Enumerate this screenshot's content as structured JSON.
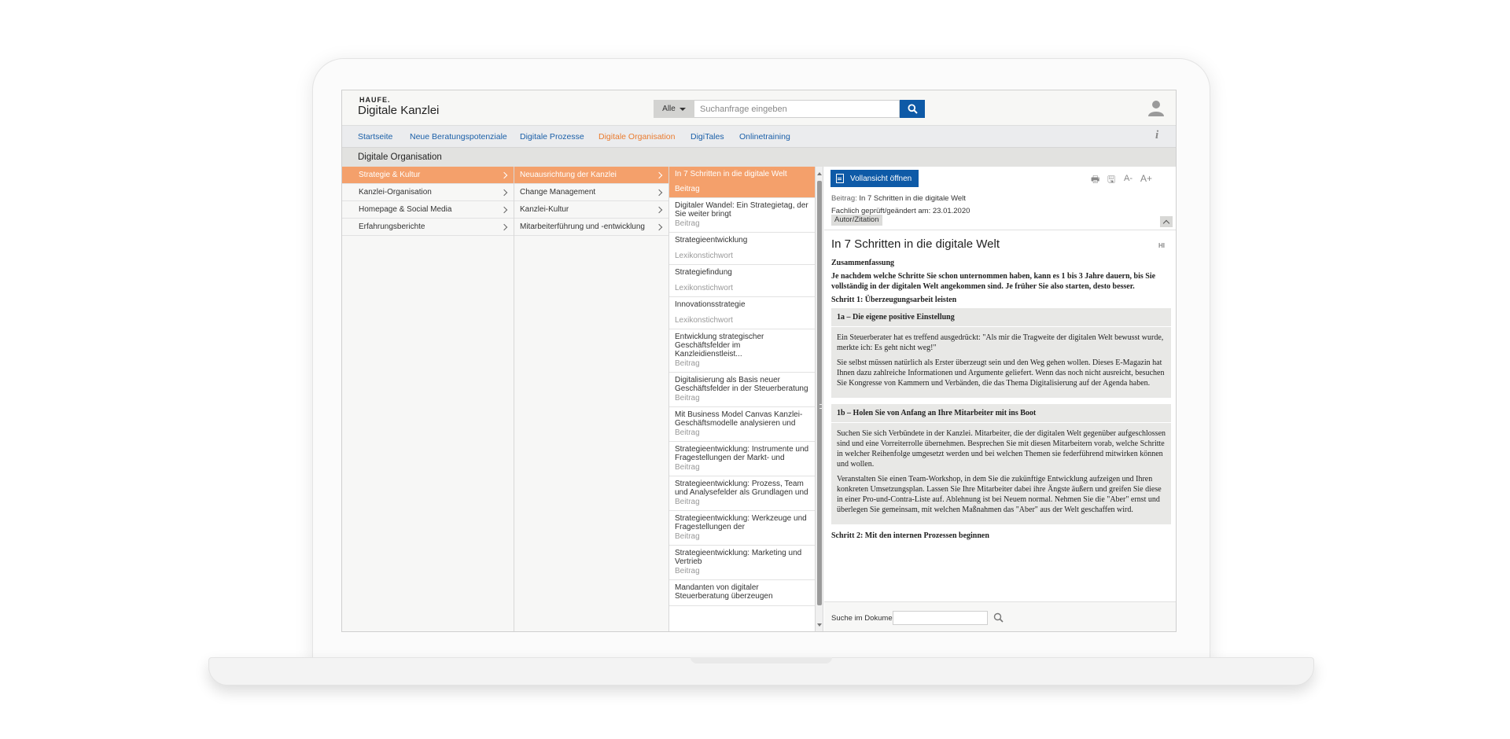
{
  "brand": {
    "small": "HAUFE.",
    "title": "Digitale Kanzlei"
  },
  "search": {
    "scope": "Alle",
    "placeholder": "Suchanfrage eingeben"
  },
  "nav": {
    "items": [
      {
        "label": "Startseite"
      },
      {
        "label": "Neue Beratungspotenziale"
      },
      {
        "label": "Digitale Prozesse"
      },
      {
        "label": "Digitale Organisation"
      },
      {
        "label": "DigiTales"
      },
      {
        "label": "Onlinetraining"
      }
    ],
    "active_index": 3
  },
  "page_title": "Digitale Organisation",
  "categories": [
    {
      "label": "Strategie & Kultur"
    },
    {
      "label": "Kanzlei-Organisation"
    },
    {
      "label": "Homepage & Social Media"
    },
    {
      "label": "Erfahrungsberichte"
    }
  ],
  "subcategories": [
    {
      "label": "Neuausrichtung der Kanzlei"
    },
    {
      "label": "Change Management"
    },
    {
      "label": "Kanzlei-Kultur"
    },
    {
      "label": "Mitarbeiterführung und -entwicklung"
    }
  ],
  "documents": [
    {
      "title": "In 7 Schritten in die digitale Welt",
      "type": "Beitrag"
    },
    {
      "title": "Digitaler Wandel: Ein Strategietag, der Sie weiter bringt",
      "type": "Beitrag"
    },
    {
      "title": "Strategieentwicklung",
      "type": "Lexikonstichwort"
    },
    {
      "title": "Strategiefindung",
      "type": "Lexikonstichwort"
    },
    {
      "title": "Innovationsstrategie",
      "type": "Lexikonstichwort"
    },
    {
      "title": "Entwicklung strategischer Geschäftsfelder im Kanzleidienstleist...",
      "type": "Beitrag"
    },
    {
      "title": "Digitalisierung als Basis neuer Geschäftsfelder in der Steuerberatung",
      "type": "Beitrag"
    },
    {
      "title": "Mit Business Model Canvas Kanzlei-Geschäftsmodelle analysieren und",
      "type": "Beitrag"
    },
    {
      "title": "Strategieentwicklung: Instrumente und Fragestellungen der Markt- und",
      "type": "Beitrag"
    },
    {
      "title": "Strategieentwicklung: Prozess, Team und Analysefelder als Grundlagen und",
      "type": "Beitrag"
    },
    {
      "title": "Strategieentwicklung: Werkzeuge und Fragestellungen der",
      "type": "Beitrag"
    },
    {
      "title": "Strategieentwicklung: Marketing und Vertrieb",
      "type": "Beitrag"
    },
    {
      "title": "Mandanten von digitaler Steuerberatung überzeugen",
      "type": ""
    }
  ],
  "detail": {
    "open_label": "Vollansicht öffnen",
    "tools": {
      "print": "🖶",
      "save": "🖫",
      "smaller": "A-",
      "larger": "A+"
    },
    "article_label": "Beitrag:",
    "article_value": "In 7 Schritten in die digitale Welt",
    "checked_label": "Fachlich geprüft/geändert am:",
    "checked_value": "23.01.2020",
    "cite_label": "Autor/Zitation",
    "title": "In 7 Schritten in die digitale Welt",
    "hl_label": "HI",
    "summary_heading": "Zusammenfassung",
    "summary_text": "Je nachdem welche Schritte Sie schon unternommen haben, kann es 1 bis 3 Jahre dauern, bis Sie vollständig in der digitalen Welt angekommen sind. Je früher Sie also starten, desto besser.",
    "step1_heading": "Schritt 1: Überzeugungsarbeit leisten",
    "box1": {
      "heading": "1a – Die eigene positive Einstellung",
      "p1": "Ein Steuerberater hat es treffend ausgedrückt: \"Als mir die Tragweite der digitalen Welt bewusst wurde, merkte ich: Es geht nicht weg!\"",
      "p2": "Sie selbst müssen natürlich als Erster überzeugt sein und den Weg gehen wollen. Dieses E-Magazin hat Ihnen dazu zahlreiche Informationen und Argumente geliefert. Wenn das noch nicht ausreicht, besuchen Sie Kongresse von Kammern und Verbänden, die das Thema Digitalisierung auf der Agenda haben."
    },
    "box2": {
      "heading": "1b – Holen Sie von Anfang an Ihre Mitarbeiter mit ins Boot",
      "p1": "Suchen Sie sich Verbündete in der Kanzlei. Mitarbeiter, die der digitalen Welt gegenüber aufgeschlossen sind und eine Vorreiterrolle übernehmen. Besprechen Sie mit diesen Mitarbeitern vorab, welche Schritte in welcher Reihenfolge umgesetzt werden und bei welchen Themen sie federführend mitwirken können und wollen.",
      "p2": "Veranstalten Sie einen Team-Workshop, in dem Sie die zukünftige Entwicklung aufzeigen und Ihren konkreten Umsetzungsplan. Lassen Sie Ihre Mitarbeiter dabei ihre Ängste äußern und greifen Sie diese in einer Pro-und-Contra-Liste auf. Ablehnung ist bei Neuem normal. Nehmen Sie die \"Aber\" ernst und überlegen Sie gemeinsam, mit welchen Maßnahmen das \"Aber\" aus der Welt geschaffen wird."
    },
    "step2_heading": "Schritt 2: Mit den internen Prozessen beginnen",
    "doc_search_label": "Suche im Dokument",
    "doc_search_value": ""
  },
  "colors": {
    "accent_orange": "#f4a06b",
    "nav_active": "#ea7b2f",
    "brand_blue": "#0e5aa7",
    "link_blue": "#1a5fa8"
  },
  "icons": {
    "search": "search-icon",
    "user": "user-icon",
    "info": "info-icon",
    "document": "document-icon"
  }
}
